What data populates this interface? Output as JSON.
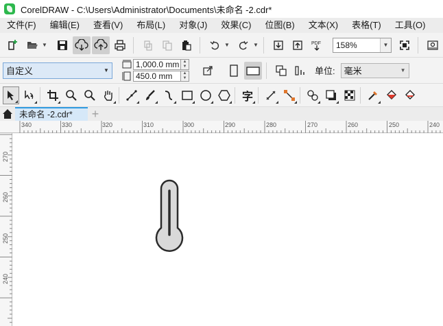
{
  "window": {
    "title": "CorelDRAW - C:\\Users\\Administrator\\Documents\\未命名 -2.cdr*"
  },
  "menu": [
    "文件(F)",
    "编辑(E)",
    "查看(V)",
    "布局(L)",
    "对象(J)",
    "效果(C)",
    "位图(B)",
    "文本(X)",
    "表格(T)",
    "工具(O)"
  ],
  "toolbar": {
    "zoom": "158%",
    "icons": [
      "new-document-icon",
      "open-folder-icon",
      "save-icon",
      "cloud-download-icon",
      "cloud-upload-icon",
      "print-icon",
      "cut-icon",
      "copy-icon",
      "paste-icon",
      "undo-icon",
      "redo-icon",
      "import-icon",
      "export-icon",
      "pdf-icon",
      "full-screen-icon",
      "options-icon"
    ],
    "pdf_label": "PDF"
  },
  "propbar": {
    "preset": "自定义",
    "width": "1,000.0 mm",
    "height": "450.0 mm",
    "unit_label": "单位:",
    "unit": "毫米"
  },
  "toolbox": [
    "pick-tool-icon",
    "shape-tool-icon",
    "crop-tool-icon",
    "zoom-tool-icon",
    "pan-tool-icon",
    "freehand-tool-icon",
    "artistic-media-icon",
    "smart-fill-icon",
    "rectangle-tool-icon",
    "ellipse-tool-icon",
    "polygon-tool-icon",
    "text-tool-icon",
    "parallel-dimension-icon",
    "connector-tool-icon",
    "blend-tool-icon",
    "drop-shadow-icon",
    "transparency-icon",
    "eyedropper-icon",
    "fill-tool-icon",
    "outline-fill-icon"
  ],
  "text_tool_glyph": "字",
  "tabs": {
    "document": "未命名 -2.cdr*",
    "add": "+"
  },
  "ruler": {
    "h_labels": [
      "340",
      "330",
      "320",
      "310",
      "300",
      "290",
      "280",
      "270",
      "260",
      "250",
      "240"
    ],
    "v_labels": [
      "270",
      "260",
      "250",
      "240"
    ]
  },
  "colors": {
    "accent": "#2f9ae0",
    "tab_bg": "#d6e8f8",
    "thermometer_fill": "#d9d9d9",
    "thermometer_stroke": "#2b2b2b"
  }
}
